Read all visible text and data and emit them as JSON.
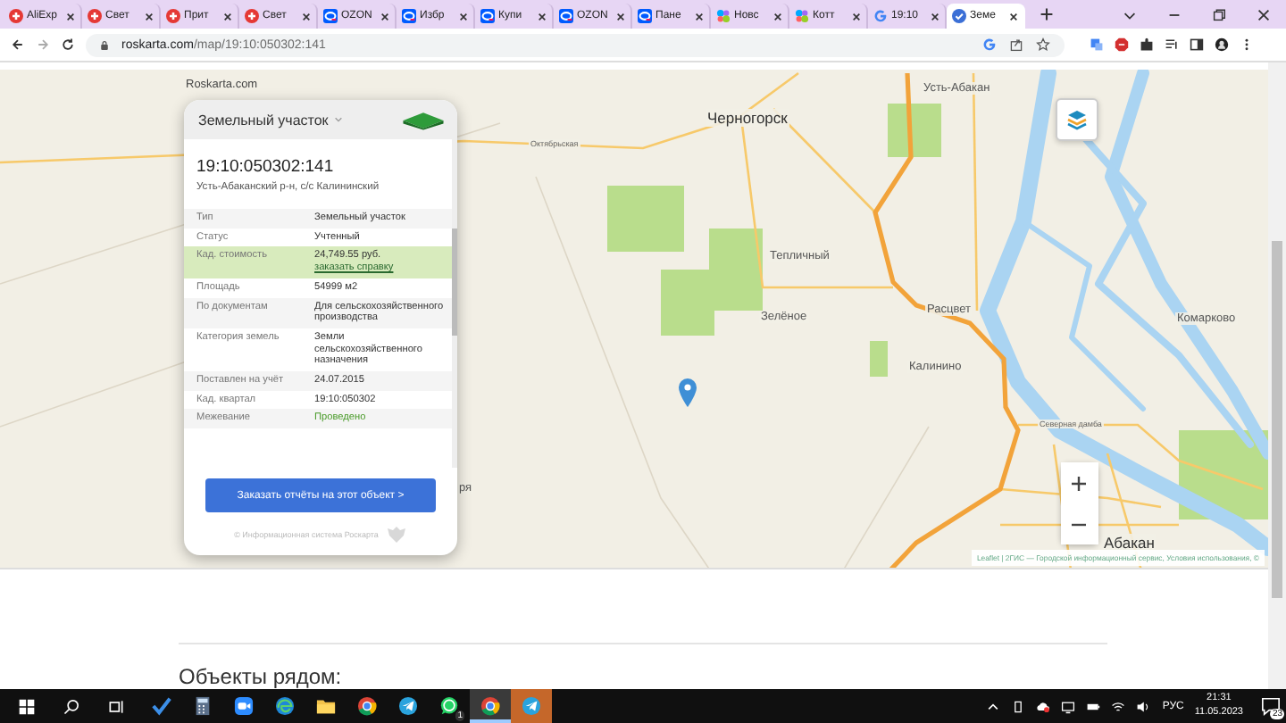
{
  "browser": {
    "tabs": [
      {
        "label": "AliExp",
        "kind": "plus",
        "selected": false
      },
      {
        "label": "Свет",
        "kind": "plus",
        "selected": false
      },
      {
        "label": "Прит",
        "kind": "plus",
        "selected": false
      },
      {
        "label": "Свет",
        "kind": "plus",
        "selected": false
      },
      {
        "label": "OZON",
        "kind": "oval",
        "selected": false
      },
      {
        "label": "Избр",
        "kind": "oval",
        "selected": false
      },
      {
        "label": "Купи",
        "kind": "oval",
        "selected": false
      },
      {
        "label": "OZON",
        "kind": "oval",
        "selected": false
      },
      {
        "label": "Пане",
        "kind": "oval",
        "selected": false
      },
      {
        "label": "Новс",
        "kind": "petals",
        "selected": false
      },
      {
        "label": "Котт",
        "kind": "petals",
        "selected": false
      },
      {
        "label": "19:10",
        "kind": "g",
        "selected": false
      },
      {
        "label": "Земе",
        "kind": "check",
        "selected": true
      }
    ],
    "url_host": "roskarta.com",
    "url_path": "/map/19:10:050302:141"
  },
  "map": {
    "site_label": "Roskarta.com",
    "places": [
      {
        "name": "Черногорск",
        "kind": "city"
      },
      {
        "name": "Усть-Абакан",
        "kind": "town"
      },
      {
        "name": "Октябрьская",
        "kind": "street"
      },
      {
        "name": "Тепличный",
        "kind": "town"
      },
      {
        "name": "Зелёное",
        "kind": "town"
      },
      {
        "name": "Расцвет",
        "kind": "town"
      },
      {
        "name": "Калинино",
        "kind": "town"
      },
      {
        "name": "Комарково",
        "kind": "town"
      },
      {
        "name": "Северная дамба",
        "kind": "street"
      },
      {
        "name": "Абакан",
        "kind": "city"
      },
      {
        "name": "ря",
        "kind": "town"
      }
    ],
    "attribution": "Leaflet | 2ГИС — Городской информационный сервис, Условия использования, ©"
  },
  "panel": {
    "title": "Земельный участок",
    "cadastral_number": "19:10:050302:141",
    "address": "Усть-Абаканский р-н, с/с Калининский",
    "rows": [
      {
        "label": "Тип",
        "highlighted": false,
        "values": [
          {
            "text": "Земельный участок",
            "kind": "text"
          }
        ]
      },
      {
        "label": "Статус",
        "highlighted": false,
        "values": [
          {
            "text": "Учтенный",
            "kind": "text"
          }
        ]
      },
      {
        "label": "Кад. стоимость",
        "highlighted": true,
        "values": [
          {
            "text": "24,749.55 руб.",
            "kind": "text"
          },
          {
            "text": "заказать справку",
            "kind": "link"
          }
        ]
      },
      {
        "label": "Площадь",
        "highlighted": false,
        "values": [
          {
            "text": "54999 м2",
            "kind": "text"
          }
        ]
      },
      {
        "label": "По документам",
        "highlighted": false,
        "values": [
          {
            "text": "Для сельскохозяйственного производства",
            "kind": "text"
          }
        ]
      },
      {
        "label": "Категория земель",
        "highlighted": false,
        "values": [
          {
            "text": "Земли сельскохозяйственного назначения",
            "kind": "text"
          }
        ]
      },
      {
        "label": "Поставлен на учёт",
        "highlighted": false,
        "values": [
          {
            "text": "24.07.2015",
            "kind": "text"
          }
        ]
      },
      {
        "label": "Кад. квартал",
        "highlighted": false,
        "values": [
          {
            "text": "19:10:050302",
            "kind": "text"
          }
        ]
      },
      {
        "label": "Межевание",
        "highlighted": false,
        "values": [
          {
            "text": "Проведено",
            "kind": "success"
          }
        ]
      }
    ],
    "order_button": "Заказать отчёты на этот объект >",
    "footer": "© Информационная система Роскарта"
  },
  "nearby_heading": "Объекты рядом:",
  "taskbar": {
    "apps": [
      {
        "kind": "checkmark",
        "selected": false,
        "flashing": false
      },
      {
        "kind": "calculator",
        "selected": false,
        "flashing": false
      },
      {
        "kind": "camera",
        "selected": false,
        "flashing": false
      },
      {
        "kind": "wave",
        "selected": false,
        "flashing": false
      },
      {
        "kind": "folder",
        "selected": false,
        "flashing": false
      },
      {
        "kind": "chrome",
        "selected": false,
        "flashing": false
      },
      {
        "kind": "telegram",
        "selected": false,
        "flashing": false
      },
      {
        "kind": "whatsapp",
        "selected": false,
        "flashing": false,
        "badge": "1"
      },
      {
        "kind": "chrome",
        "selected": true,
        "flashing": false
      },
      {
        "kind": "telegram",
        "selected": false,
        "flashing": true
      }
    ],
    "language": "РУС",
    "time": "21:31",
    "date": "11.05.2023",
    "notifications": "23"
  }
}
